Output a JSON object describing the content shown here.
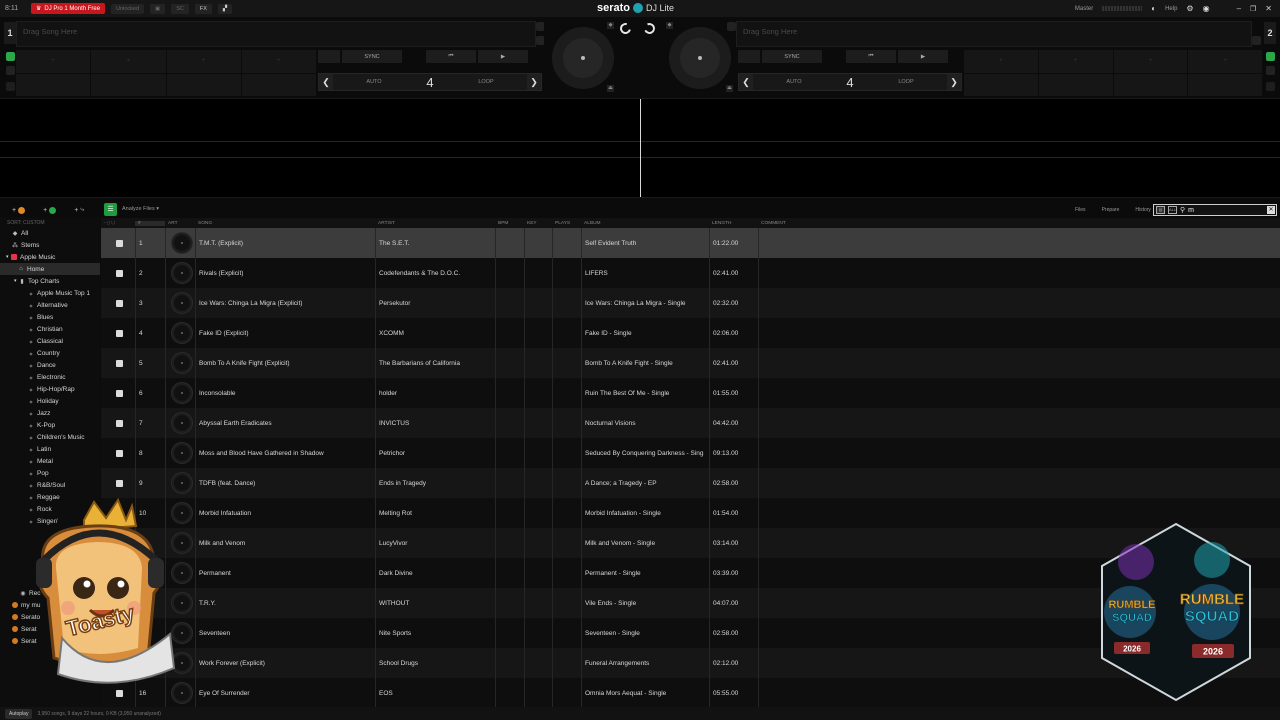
{
  "topbar": {
    "clock": "8:11",
    "promo": "DJ Pro 1 Month Free",
    "chip_unlocked": "Unlocked",
    "chip_sc": "SC",
    "chip_fx": "FX",
    "brand": "serato",
    "brand_suffix": "DJ Lite",
    "master_label": "Master",
    "help_label": "Help"
  },
  "deck1": {
    "number": "1",
    "drag_text": "Drag Song Here",
    "sync": "SYNC",
    "auto": "AUTO",
    "loop_value": "4",
    "loop": "LOOP"
  },
  "deck2": {
    "number": "2",
    "drag_text": "Drag Song Here",
    "sync": "SYNC",
    "auto": "AUTO",
    "loop_value": "4",
    "loop": "LOOP"
  },
  "library": {
    "analyze": "Analyze Files",
    "tabs": [
      "Files",
      "Prepare",
      "History"
    ],
    "search_toggle": "ALL",
    "search_value": "m"
  },
  "sidebar": {
    "sort_label": "SORT: CUSTOM",
    "items": [
      {
        "label": "All"
      },
      {
        "label": "Stems"
      },
      {
        "label": "Apple Music"
      },
      {
        "label": "Home"
      },
      {
        "label": "Top Charts"
      },
      {
        "label": "Apple Music Top 1"
      },
      {
        "label": "Alternative"
      },
      {
        "label": "Blues"
      },
      {
        "label": "Christian"
      },
      {
        "label": "Classical"
      },
      {
        "label": "Country"
      },
      {
        "label": "Dance"
      },
      {
        "label": "Electronic"
      },
      {
        "label": "Hip-Hop/Rap"
      },
      {
        "label": "Holiday"
      },
      {
        "label": "Jazz"
      },
      {
        "label": "K-Pop"
      },
      {
        "label": "Children's Music"
      },
      {
        "label": "Latin"
      },
      {
        "label": "Metal"
      },
      {
        "label": "Pop"
      },
      {
        "label": "R&B/Soul"
      },
      {
        "label": "Reggae"
      },
      {
        "label": "Rock"
      },
      {
        "label": "Singer/"
      }
    ],
    "bottom_items": [
      {
        "label": "Rec"
      },
      {
        "label": "my mu"
      },
      {
        "label": "Serato"
      },
      {
        "label": "Serat"
      },
      {
        "label": "Serat"
      }
    ]
  },
  "columns": {
    "num": "#",
    "art": "ART",
    "song": "SONG",
    "artist": "ARTIST",
    "bpm": "BPM",
    "key": "KEY",
    "plays": "PLAYS",
    "album": "ALBUM",
    "length": "LENGTH",
    "comment": "COMMENT"
  },
  "tracks": [
    {
      "num": "1",
      "song": "T.M.T. (Explicit)",
      "artist": "The S.E.T.",
      "album": "Self Evident Truth",
      "length": "01:22.00"
    },
    {
      "num": "2",
      "song": "Rivals (Explicit)",
      "artist": "Codefendants & The D.O.C.",
      "album": "LIFERS",
      "length": "02:41.00"
    },
    {
      "num": "3",
      "song": "Ice Wars: Chinga La Migra (Explicit)",
      "artist": "Persekutor",
      "album": "Ice Wars: Chinga La Migra - Single",
      "length": "02:32.00"
    },
    {
      "num": "4",
      "song": "Fake ID (Explicit)",
      "artist": "XCOMM",
      "album": "Fake ID - Single",
      "length": "02:06.00"
    },
    {
      "num": "5",
      "song": "Bomb To A Knife Fight (Explicit)",
      "artist": "The Barbarians of California",
      "album": "Bomb To A Knife Fight - Single",
      "length": "02:41.00"
    },
    {
      "num": "6",
      "song": "Inconsolable",
      "artist": "holder",
      "album": "Ruin The Best Of Me - Single",
      "length": "01:55.00"
    },
    {
      "num": "7",
      "song": "Abyssal Earth Eradicates",
      "artist": "INVICTUS",
      "album": "Nocturnal Visions",
      "length": "04:42.00"
    },
    {
      "num": "8",
      "song": "Moss and Blood Have Gathered in Shadow",
      "artist": "Petrichor",
      "album": "Seduced By Conquering Darkness - Sing",
      "length": "09:13.00"
    },
    {
      "num": "9",
      "song": "TDFB (feat. Dance)",
      "artist": "Ends in Tragedy",
      "album": "A Dance; a Tragedy - EP",
      "length": "02:58.00"
    },
    {
      "num": "10",
      "song": "Morbid Infatuation",
      "artist": "Melting Rot",
      "album": "Morbid Infatuation - Single",
      "length": "01:54.00"
    },
    {
      "num": "11",
      "song": "Milk and Venom",
      "artist": "LucyVivor",
      "album": "Milk and Venom - Single",
      "length": "03:14.00"
    },
    {
      "num": "12",
      "song": "Permanent",
      "artist": "Dark Divine",
      "album": "Permanent - Single",
      "length": "03:39.00"
    },
    {
      "num": "13",
      "song": "T.R.Y.",
      "artist": "WITHOUT",
      "album": "Vile Ends - Single",
      "length": "04:07.00"
    },
    {
      "num": "14",
      "song": "Seventeen",
      "artist": "Nite Sports",
      "album": "Seventeen - Single",
      "length": "02:58.00"
    },
    {
      "num": "15",
      "song": "Work Forever (Explicit)",
      "artist": "School Drugs",
      "album": "Funeral Arrangements",
      "length": "02:12.00"
    },
    {
      "num": "16",
      "song": "Eye Of Surrender",
      "artist": "EOS",
      "album": "Omnia Mors Aequat - Single",
      "length": "05:55.00"
    }
  ],
  "status": {
    "autoplay": "Autoplay",
    "summary": "3,950 songs, 9 days 22 hours, 0 KB (3,950 unanalyzed)"
  },
  "overlays": {
    "toast_text": "Toasty",
    "rumble_line1": "RUMBLE",
    "rumble_line2": "SQUAD",
    "rumble_year": "2026"
  },
  "colors": {
    "accent_green": "#1f9c3b",
    "promo_red": "#c8161d",
    "crate_orange": "#d47a1e",
    "serato_teal": "#1fa3ae"
  }
}
